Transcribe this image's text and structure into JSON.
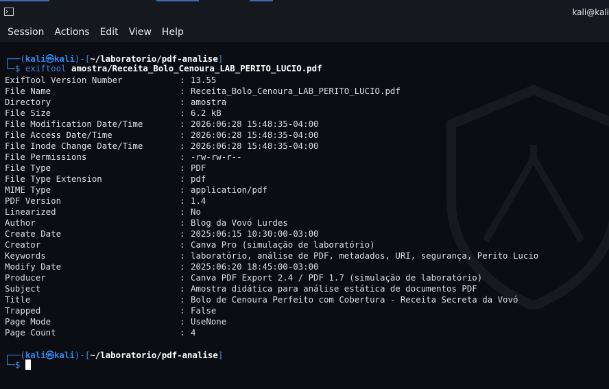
{
  "window": {
    "title": "kali@kali"
  },
  "menu": [
    "Session",
    "Actions",
    "Edit",
    "View",
    "Help"
  ],
  "prompt": {
    "open": "┌──(",
    "user": "kali㉿kali",
    "mid": ")-[",
    "path": "~/laboratorio/pdf-analise",
    "close": "]",
    "second": "└─$ "
  },
  "command": {
    "name": "exiftool",
    "arg": "amostra/Receita_Bolo_Cenoura_LAB_PERITO_LUCIO.pdf"
  },
  "output": [
    {
      "key": "ExifTool Version Number",
      "value": "13.55"
    },
    {
      "key": "File Name",
      "value": "Receita_Bolo_Cenoura_LAB_PERITO_LUCIO.pdf"
    },
    {
      "key": "Directory",
      "value": "amostra"
    },
    {
      "key": "File Size",
      "value": "6.2 kB"
    },
    {
      "key": "File Modification Date/Time",
      "value": "2026:06:28 15:48:35-04:00"
    },
    {
      "key": "File Access Date/Time",
      "value": "2026:06:28 15:48:35-04:00"
    },
    {
      "key": "File Inode Change Date/Time",
      "value": "2026:06:28 15:48:35-04:00"
    },
    {
      "key": "File Permissions",
      "value": "-rw-rw-r--"
    },
    {
      "key": "File Type",
      "value": "PDF"
    },
    {
      "key": "File Type Extension",
      "value": "pdf"
    },
    {
      "key": "MIME Type",
      "value": "application/pdf"
    },
    {
      "key": "PDF Version",
      "value": "1.4"
    },
    {
      "key": "Linearized",
      "value": "No"
    },
    {
      "key": "Author",
      "value": "Blog da Vovó Lurdes"
    },
    {
      "key": "Create Date",
      "value": "2025:06:15 10:30:00-03:00"
    },
    {
      "key": "Creator",
      "value": "Canva Pro (simulação de laboratório)"
    },
    {
      "key": "Keywords",
      "value": "laboratório, análise de PDF, metadados, URI, segurança, Perito Lucio"
    },
    {
      "key": "Modify Date",
      "value": "2025:06:20 18:45:00-03:00"
    },
    {
      "key": "Producer",
      "value": "Canva PDF Export 2.4 / PDF 1.7 (simulação de laboratório)"
    },
    {
      "key": "Subject",
      "value": "Amostra didática para análise estática de documentos PDF"
    },
    {
      "key": "Title",
      "value": "Bolo de Cenoura Perfeito com Cobertura - Receita Secreta da Vovó"
    },
    {
      "key": "Trapped",
      "value": "False"
    },
    {
      "key": "Page Mode",
      "value": "UseNone"
    },
    {
      "key": "Page Count",
      "value": "4"
    }
  ],
  "separator": ": ",
  "colors": {
    "prompt": "#3b8eea",
    "background": "#0c0d12",
    "text": "#dcdfe4"
  },
  "icons": {
    "app": "terminal-icon"
  }
}
